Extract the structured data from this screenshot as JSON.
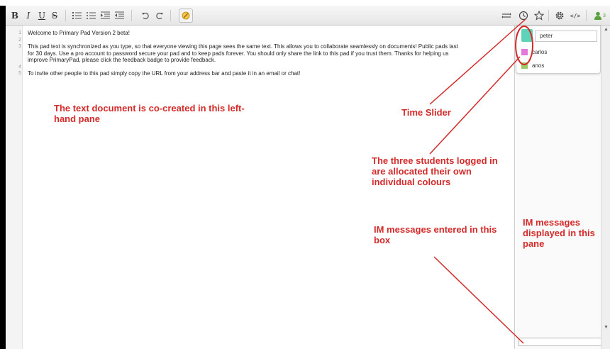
{
  "toolbar": {
    "left_buttons": [
      {
        "name": "bold-button",
        "label": "B"
      },
      {
        "name": "italic-button",
        "label": "I"
      },
      {
        "name": "underline-button",
        "label": "U"
      },
      {
        "name": "strikethrough-button",
        "label": "S"
      }
    ],
    "list_icons": [
      "ordered-list-icon",
      "bullet-list-icon",
      "indent-icon",
      "outdent-icon"
    ],
    "history_icons": [
      "undo-icon",
      "redo-icon"
    ],
    "right_icons": [
      "import-export-icon",
      "time-slider-icon",
      "star-icon",
      "settings-icon",
      "embed-icon"
    ],
    "user_count": "3",
    "accent": "#5aa03c"
  },
  "editor": {
    "lines": [
      {
        "num": "1",
        "text": "Welcome to Primary Pad Version 2 beta!"
      },
      {
        "num": "2",
        "text": ""
      },
      {
        "num": "3",
        "text": "This pad text is synchronized as you type, so that everyone viewing this page sees the same text.  This allows you to collaborate seamlessly on documents!  Public pads last"
      },
      {
        "num": "",
        "text": "for 30 days.  Use a pro account to password secure your pad and to keep pads forever.  You should only share the link to this pad if you trust them.  Thanks for helping us"
      },
      {
        "num": "",
        "text": "improve PrimaryPad, please click the feedback badge to provide feedback."
      },
      {
        "num": "4",
        "text": ""
      },
      {
        "num": "5",
        "text": "To invite other people to this pad simply copy the URL from your address bar and paste it in an email or chat!"
      }
    ]
  },
  "users": [
    {
      "name": "peter",
      "color": "#5fd3b8"
    },
    {
      "name": "carlos",
      "color": "#e278d8"
    },
    {
      "name": "anos",
      "color": "#9ccb6a"
    }
  ],
  "annotations": {
    "text_pane": "The text document is co-created in this left-hand pane",
    "time_slider": "Time Slider",
    "students": "The three students logged in are allocated their own individual colours",
    "im_entered": "IM messages entered in this box",
    "im_displayed": "IM messages displayed in this pane",
    "color": "#d42a2a"
  }
}
